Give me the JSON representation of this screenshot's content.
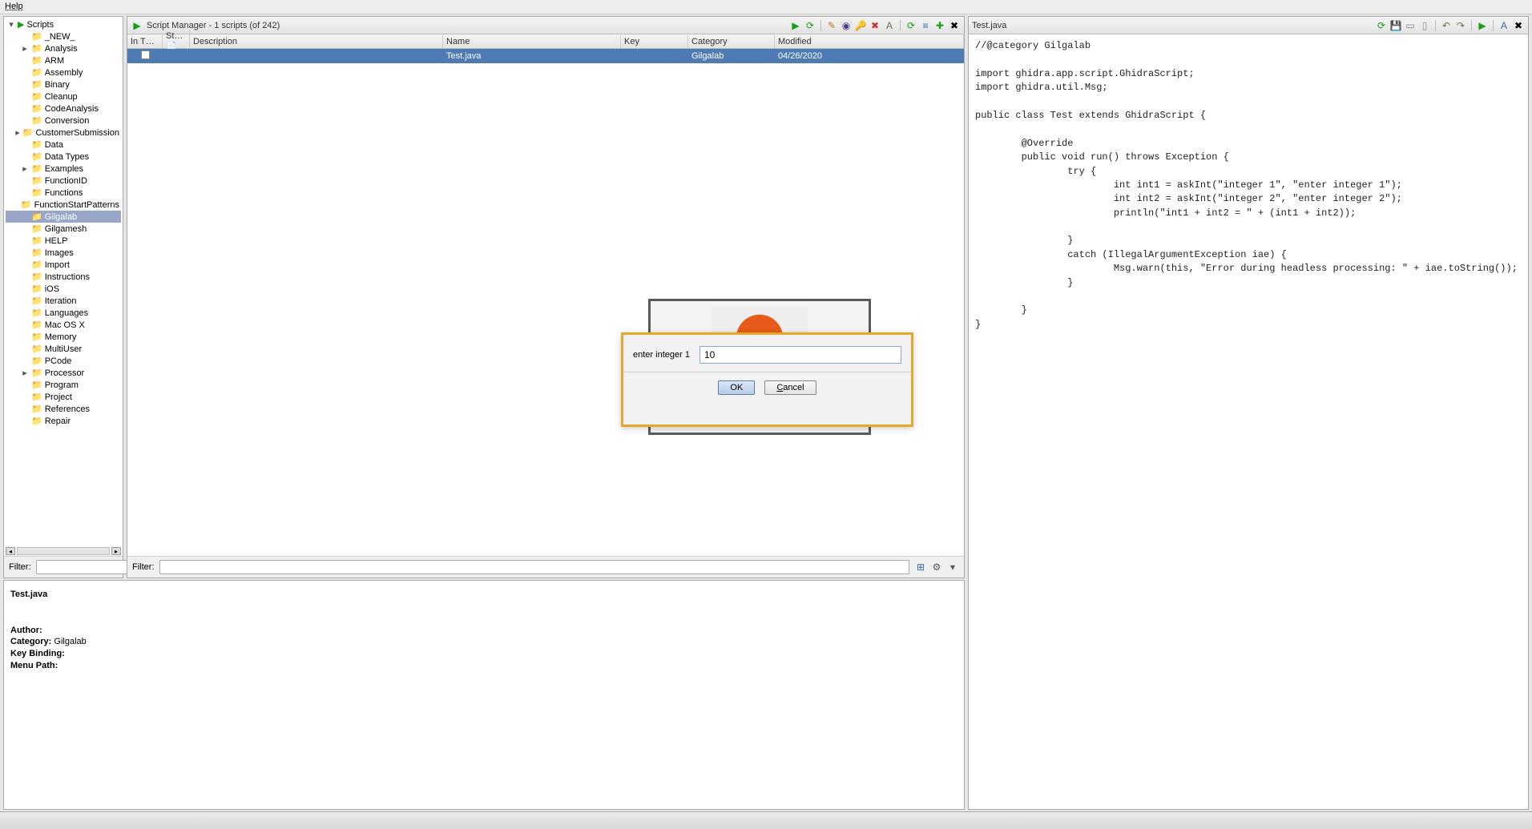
{
  "menubar": {
    "help": "Help"
  },
  "scriptManager": {
    "title": "Script Manager - 1 scripts  (of 242)",
    "treeRoot": "Scripts",
    "categories": [
      {
        "label": "_NEW_",
        "expand": ""
      },
      {
        "label": "Analysis",
        "expand": "▸"
      },
      {
        "label": "ARM",
        "expand": ""
      },
      {
        "label": "Assembly",
        "expand": ""
      },
      {
        "label": "Binary",
        "expand": ""
      },
      {
        "label": "Cleanup",
        "expand": ""
      },
      {
        "label": "CodeAnalysis",
        "expand": ""
      },
      {
        "label": "Conversion",
        "expand": ""
      },
      {
        "label": "CustomerSubmission",
        "expand": "▸"
      },
      {
        "label": "Data",
        "expand": ""
      },
      {
        "label": "Data Types",
        "expand": ""
      },
      {
        "label": "Examples",
        "expand": "▸"
      },
      {
        "label": "FunctionID",
        "expand": ""
      },
      {
        "label": "Functions",
        "expand": ""
      },
      {
        "label": "FunctionStartPatterns",
        "expand": ""
      },
      {
        "label": "Gilgalab",
        "expand": "",
        "selected": true
      },
      {
        "label": "Gilgamesh",
        "expand": ""
      },
      {
        "label": "HELP",
        "expand": ""
      },
      {
        "label": "Images",
        "expand": ""
      },
      {
        "label": "Import",
        "expand": ""
      },
      {
        "label": "Instructions",
        "expand": ""
      },
      {
        "label": "iOS",
        "expand": ""
      },
      {
        "label": "Iteration",
        "expand": ""
      },
      {
        "label": "Languages",
        "expand": ""
      },
      {
        "label": "Mac OS X",
        "expand": ""
      },
      {
        "label": "Memory",
        "expand": ""
      },
      {
        "label": "MultiUser",
        "expand": ""
      },
      {
        "label": "PCode",
        "expand": ""
      },
      {
        "label": "Processor",
        "expand": "▸"
      },
      {
        "label": "Program",
        "expand": ""
      },
      {
        "label": "Project",
        "expand": ""
      },
      {
        "label": "References",
        "expand": ""
      },
      {
        "label": "Repair",
        "expand": ""
      }
    ],
    "columns": {
      "intool": "In T…",
      "status": "St…",
      "desc": "Description",
      "name": "Name",
      "key": "Key",
      "cat": "Category",
      "mod": "Modified"
    },
    "rows": [
      {
        "desc": "",
        "name": "Test.java",
        "key": "",
        "cat": "Gilgalab",
        "mod": "04/26/2020"
      }
    ],
    "filterLabel": "Filter:"
  },
  "meta": {
    "filename": "Test.java",
    "authorLabel": "Author:",
    "authorValue": "",
    "categoryLabel": "Category:",
    "categoryValue": "Gilgalab",
    "keyLabel": "Key Binding:",
    "keyValue": "",
    "menuLabel": "Menu Path:",
    "menuValue": ""
  },
  "editor": {
    "tabTitle": "Test.java",
    "code": "//@category Gilgalab\n\nimport ghidra.app.script.GhidraScript;\nimport ghidra.util.Msg;\n\npublic class Test extends GhidraScript {\n\n        @Override\n        public void run() throws Exception {\n                try {\n                        int int1 = askInt(\"integer 1\", \"enter integer 1\");\n                        int int2 = askInt(\"integer 2\", \"enter integer 2\");\n                        println(\"int1 + int2 = \" + (int1 + int2));\n\n                }\n                catch (IllegalArgumentException iae) {\n                        Msg.warn(this, \"Error during headless processing: \" + iae.toString());\n                }\n\n        }\n}"
  },
  "dialog": {
    "promptLabel": "enter integer 1",
    "inputValue": "10",
    "ok": "OK",
    "cancel": "Cancel"
  }
}
